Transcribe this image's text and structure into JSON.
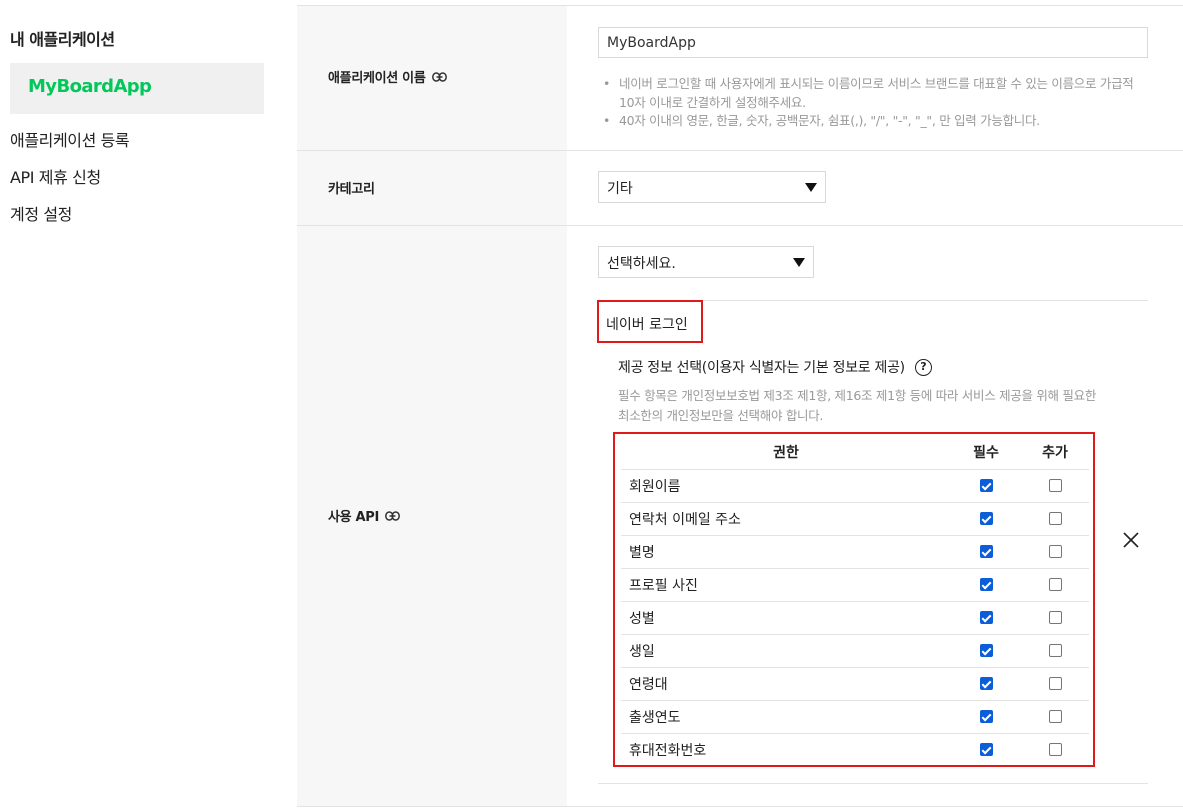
{
  "sidebar": {
    "heading": "내 애플리케이션",
    "active_app": "MyBoardApp",
    "links": [
      "애플리케이션 등록",
      "API 제휴 신청",
      "계정 설정"
    ]
  },
  "form": {
    "app_name": {
      "label": "애플리케이션 이름",
      "value": "MyBoardApp",
      "help": [
        "네이버 로그인할 때 사용자에게 표시되는 이름이므로 서비스 브랜드를 대표할 수 있는 이름으로 가급적 10자 이내로 간결하게 설정해주세요.",
        "40자 이내의 영문, 한글, 숫자, 공백문자, 쉼표(,), \"/\", \"-\", \"_\", 만 입력 가능합니다."
      ]
    },
    "category": {
      "label": "카테고리",
      "selected": "기타"
    },
    "api": {
      "label": "사용 API",
      "select_placeholder": "선택하세요.",
      "api_name": "네이버 로그인",
      "info_title": "제공 정보 선택(이용자 식별자는 기본 정보로 제공)",
      "info_help_icon": "?",
      "info_desc": "필수 항목은 개인정보보호법 제3조 제1항, 제16조 제1항 등에 따라 서비스 제공을 위해 필요한 최소한의 개인정보만을 선택해야 합니다.",
      "table": {
        "headers": [
          "권한",
          "필수",
          "추가"
        ],
        "rows": [
          {
            "name": "회원이름",
            "required": true,
            "additional": false
          },
          {
            "name": "연락처 이메일 주소",
            "required": true,
            "additional": false
          },
          {
            "name": "별명",
            "required": true,
            "additional": false
          },
          {
            "name": "프로필 사진",
            "required": true,
            "additional": false
          },
          {
            "name": "성별",
            "required": true,
            "additional": false
          },
          {
            "name": "생일",
            "required": true,
            "additional": false
          },
          {
            "name": "연령대",
            "required": true,
            "additional": false
          },
          {
            "name": "출생연도",
            "required": true,
            "additional": false
          },
          {
            "name": "휴대전화번호",
            "required": true,
            "additional": false
          }
        ]
      }
    }
  },
  "colors": {
    "brand_green": "#03c75a",
    "highlight_red": "#e01a1a",
    "checkbox_blue": "#0b5ed7"
  }
}
